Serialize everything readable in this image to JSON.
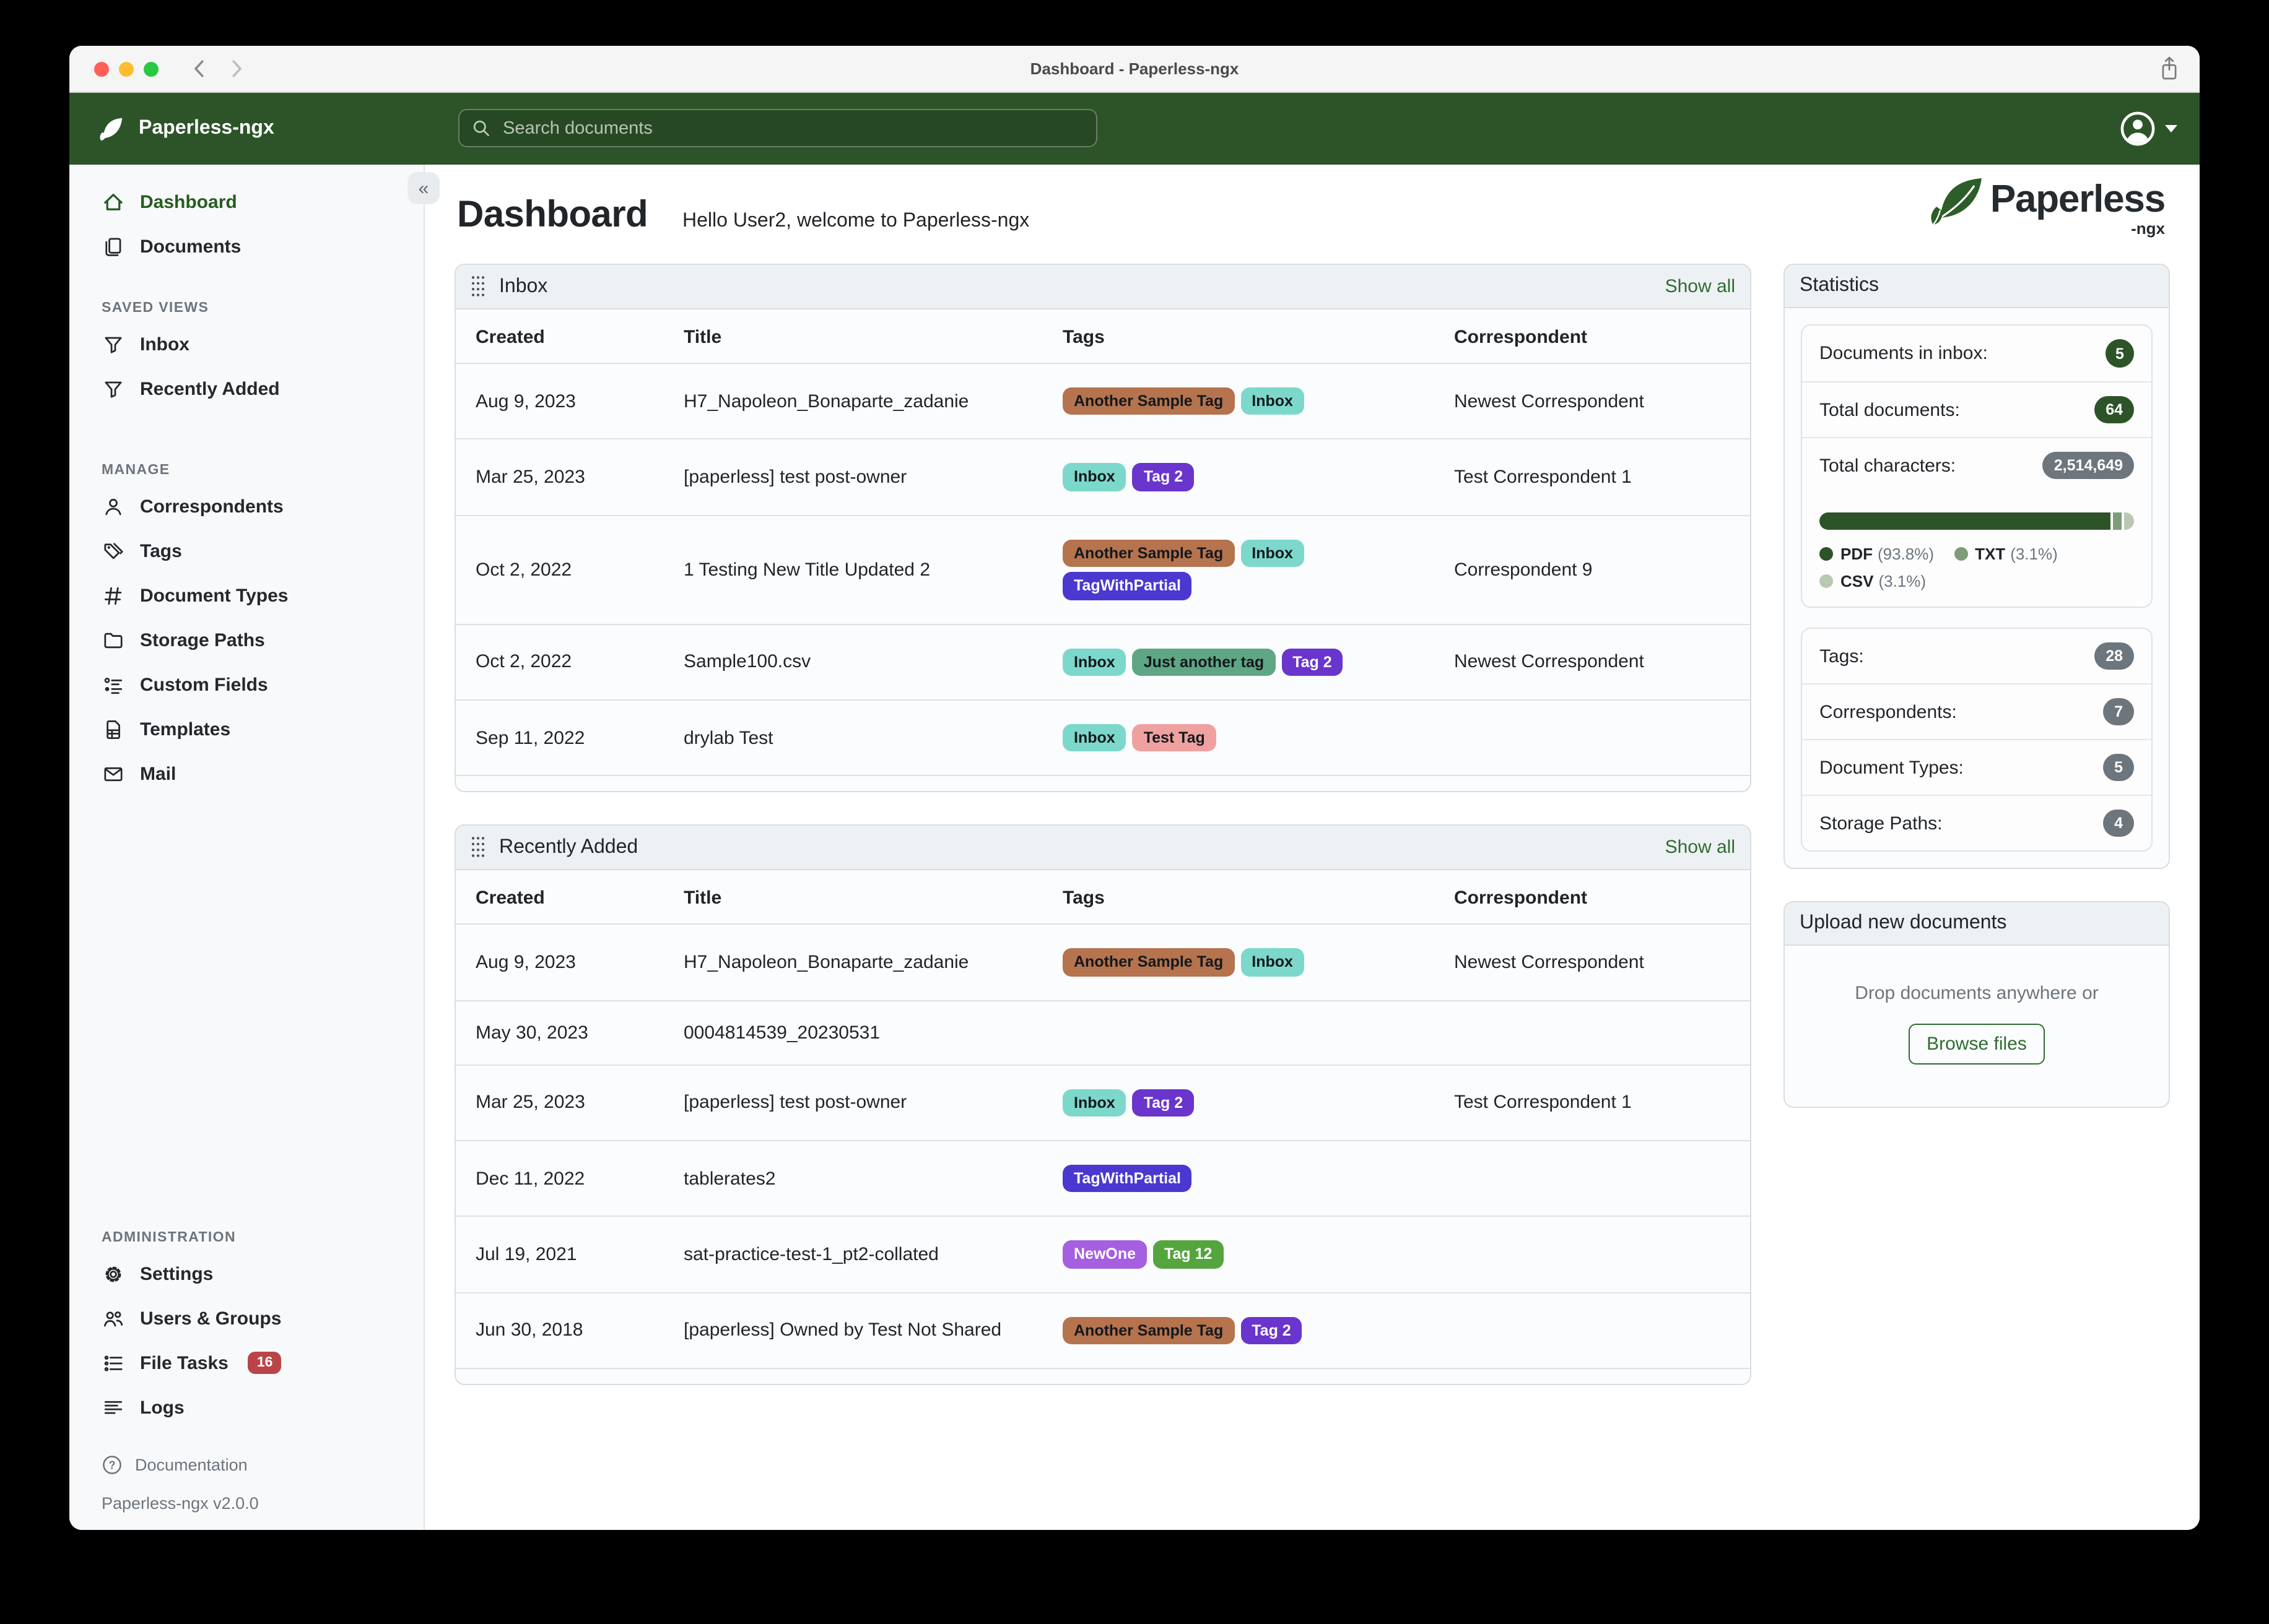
{
  "titlebar": {
    "title": "Dashboard - Paperless-ngx"
  },
  "navbar": {
    "brand": "Paperless-ngx",
    "search_placeholder": "Search documents"
  },
  "sidebar": {
    "primary": [
      {
        "label": "Dashboard",
        "icon": "home",
        "active": true
      },
      {
        "label": "Documents",
        "icon": "documents"
      }
    ],
    "sections": [
      {
        "label": "SAVED VIEWS",
        "gap": "md",
        "items": [
          {
            "label": "Inbox",
            "icon": "funnel"
          },
          {
            "label": "Recently Added",
            "icon": "funnel"
          }
        ]
      },
      {
        "label": "MANAGE",
        "gap": "lg",
        "items": [
          {
            "label": "Correspondents",
            "icon": "person"
          },
          {
            "label": "Tags",
            "icon": "tag"
          },
          {
            "label": "Document Types",
            "icon": "hash"
          },
          {
            "label": "Storage Paths",
            "icon": "folder"
          },
          {
            "label": "Custom Fields",
            "icon": "custom-fields"
          },
          {
            "label": "Templates",
            "icon": "file"
          },
          {
            "label": "Mail",
            "icon": "mail"
          }
        ]
      },
      {
        "label": "ADMINISTRATION",
        "push_bottom": true,
        "items": [
          {
            "label": "Settings",
            "icon": "gear"
          },
          {
            "label": "Users & Groups",
            "icon": "users"
          },
          {
            "label": "File Tasks",
            "icon": "tasks",
            "badge": "16"
          },
          {
            "label": "Logs",
            "icon": "logs"
          }
        ]
      }
    ],
    "footer": {
      "documentation": "Documentation",
      "version": "Paperless-ngx v2.0.0"
    }
  },
  "page": {
    "title": "Dashboard",
    "subtitle": "Hello User2, welcome to Paperless-ngx",
    "logo_word": "Paperless",
    "logo_suffix": "-ngx"
  },
  "widgets": [
    {
      "title": "Inbox",
      "show_all": "Show all",
      "columns": [
        "Created",
        "Title",
        "Tags",
        "Correspondent"
      ],
      "rows": [
        {
          "created": "Aug 9, 2023",
          "title": "H7_Napoleon_Bonaparte_zadanie",
          "tags": [
            "Another Sample Tag",
            "Inbox"
          ],
          "correspondent": "Newest Correspondent"
        },
        {
          "created": "Mar 25, 2023",
          "title": "[paperless] test post-owner",
          "tags": [
            "Inbox",
            "Tag 2"
          ],
          "correspondent": "Test Correspondent 1"
        },
        {
          "created": "Oct 2, 2022",
          "title": "1 Testing New Title Updated 2",
          "tags": [
            "Another Sample Tag",
            "Inbox",
            "TagWithPartial"
          ],
          "correspondent": "Correspondent 9"
        },
        {
          "created": "Oct 2, 2022",
          "title": "Sample100.csv",
          "tags": [
            "Inbox",
            "Just another tag",
            "Tag 2"
          ],
          "correspondent": "Newest Correspondent"
        },
        {
          "created": "Sep 11, 2022",
          "title": "drylab Test",
          "tags": [
            "Inbox",
            "Test Tag"
          ],
          "correspondent": ""
        }
      ]
    },
    {
      "title": "Recently Added",
      "show_all": "Show all",
      "columns": [
        "Created",
        "Title",
        "Tags",
        "Correspondent"
      ],
      "rows": [
        {
          "created": "Aug 9, 2023",
          "title": "H7_Napoleon_Bonaparte_zadanie",
          "tags": [
            "Another Sample Tag",
            "Inbox"
          ],
          "correspondent": "Newest Correspondent"
        },
        {
          "created": "May 30, 2023",
          "title": "0004814539_20230531",
          "tags": [],
          "correspondent": ""
        },
        {
          "created": "Mar 25, 2023",
          "title": "[paperless] test post-owner",
          "tags": [
            "Inbox",
            "Tag 2"
          ],
          "correspondent": "Test Correspondent 1"
        },
        {
          "created": "Dec 11, 2022",
          "title": "tablerates2",
          "tags": [
            "TagWithPartial"
          ],
          "correspondent": ""
        },
        {
          "created": "Jul 19, 2021",
          "title": "sat-practice-test-1_pt2-collated",
          "tags": [
            "NewOne",
            "Tag 12"
          ],
          "correspondent": ""
        },
        {
          "created": "Jun 30, 2018",
          "title": "[paperless] Owned by Test Not Shared",
          "tags": [
            "Another Sample Tag",
            "Tag 2"
          ],
          "correspondent": ""
        }
      ]
    }
  ],
  "tag_styles": {
    "Another Sample Tag": {
      "bg": "#b5734e",
      "fg": "#14181c"
    },
    "Inbox": {
      "bg": "#7cd8cb",
      "fg": "#14181c"
    },
    "Tag 2": {
      "bg": "#6a35cc",
      "fg": "#ffffff"
    },
    "TagWithPartial": {
      "bg": "#4a38d0",
      "fg": "#ffffff"
    },
    "Just another tag": {
      "bg": "#5fa685",
      "fg": "#14181c"
    },
    "Test Tag": {
      "bg": "#efa1a0",
      "fg": "#14181c"
    },
    "NewOne": {
      "bg": "#a55fe0",
      "fg": "#ffffff"
    },
    "Tag 12": {
      "bg": "#55a53e",
      "fg": "#ffffff"
    }
  },
  "statistics": {
    "title": "Statistics",
    "rows": [
      {
        "label": "Documents in inbox:",
        "value": "5",
        "style": "green-circle"
      },
      {
        "label": "Total documents:",
        "value": "64",
        "style": "green"
      },
      {
        "label": "Total characters:",
        "value": "2,514,649",
        "style": "gray"
      }
    ],
    "chart_data": {
      "type": "bar",
      "title": "Document file type distribution",
      "categories": [
        "PDF",
        "TXT",
        "CSV"
      ],
      "values": [
        93.8,
        3.1,
        3.1
      ],
      "unit": "%",
      "colors": [
        "#2d5429",
        "#7f9c78",
        "#b9c8b3"
      ],
      "legend": [
        "PDF (93.8%)",
        "TXT (3.1%)",
        "CSV (3.1%)"
      ]
    },
    "counts": [
      {
        "label": "Tags:",
        "value": "28",
        "style": "gray"
      },
      {
        "label": "Correspondents:",
        "value": "7",
        "style": "gray"
      },
      {
        "label": "Document Types:",
        "value": "5",
        "style": "gray"
      },
      {
        "label": "Storage Paths:",
        "value": "4",
        "style": "gray"
      }
    ]
  },
  "upload": {
    "title": "Upload new documents",
    "drop_text": "Drop documents anywhere or",
    "browse_label": "Browse files"
  },
  "colors": {
    "navbar_green": "#2d5429",
    "accent_green": "#265c22",
    "link_green": "#2f6b31",
    "badge_red": "#bb4449",
    "traffic_lights": [
      "#ff5f57",
      "#febc2e",
      "#28c840"
    ]
  }
}
